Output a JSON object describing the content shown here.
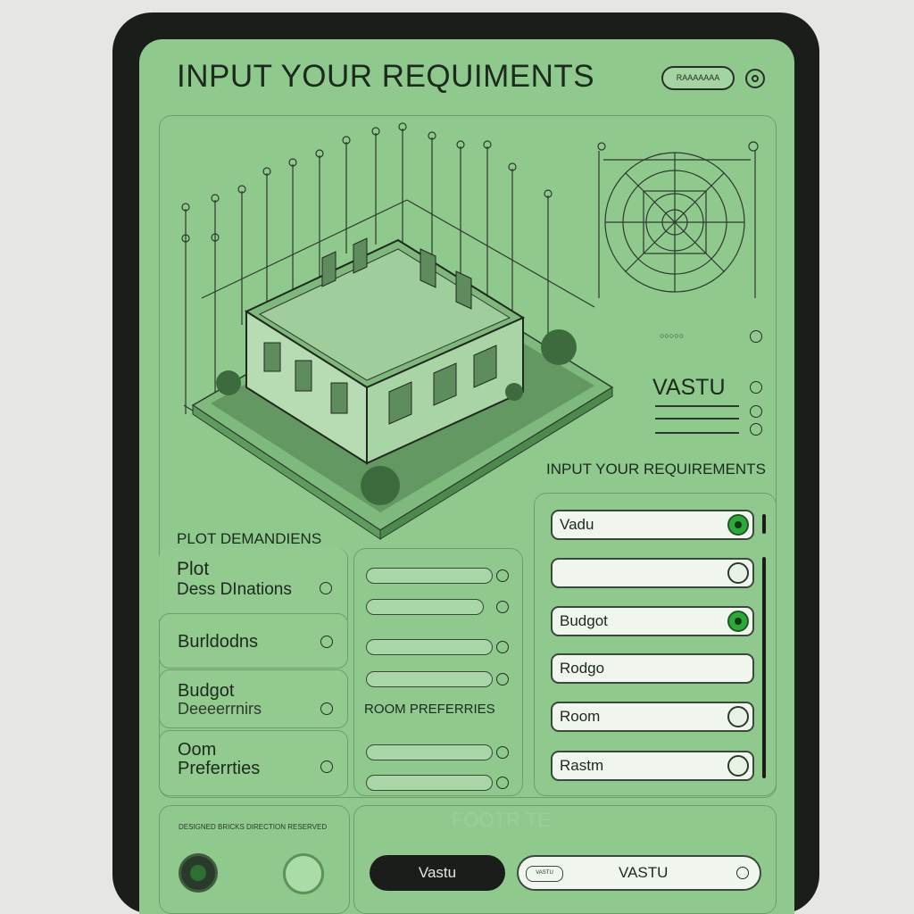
{
  "header": {
    "title": "INPUT YOUR REQUIMENTS",
    "pill_button": "RAAAAAAA"
  },
  "illustration": {
    "compass_dots": [
      "○○○○○",
      "○"
    ]
  },
  "vastu_panel": {
    "title": "VASTU"
  },
  "requirements_heading": "INPUT YOUR REQUIREMENTS",
  "left_panel": {
    "heading": "PLOT DEMANDIENS",
    "items": [
      {
        "line1": "Plot",
        "line2": "Dess DInations"
      },
      {
        "line1": "Burldodns",
        "line2": ""
      },
      {
        "line1": "Budgot",
        "line2": "Deeeerrnirs"
      },
      {
        "line1": "Oom",
        "line2": "Preferrties"
      }
    ]
  },
  "middle_panel": {
    "section_label": "ROOM PREFERRIES"
  },
  "fields": [
    {
      "value": "Vadu",
      "state": "on"
    },
    {
      "value": "",
      "state": "off"
    },
    {
      "value": "Budgot",
      "state": "on"
    },
    {
      "value": "Rodgo",
      "state": "off"
    },
    {
      "value": "Room",
      "state": "partial"
    },
    {
      "value": "Rastm",
      "state": "partial"
    }
  ],
  "footer": {
    "small_text": "DESIGNED BRICKS DIRECTION RESERVED",
    "dark_button": "Vastu",
    "input_prefix": "VASTU",
    "input_value": "VASTU",
    "watermark": "FOOTR TE"
  },
  "colors": {
    "screen_bg": "#8fc98e",
    "accent_green": "#2ea83a",
    "dark": "#1b1d1b"
  }
}
